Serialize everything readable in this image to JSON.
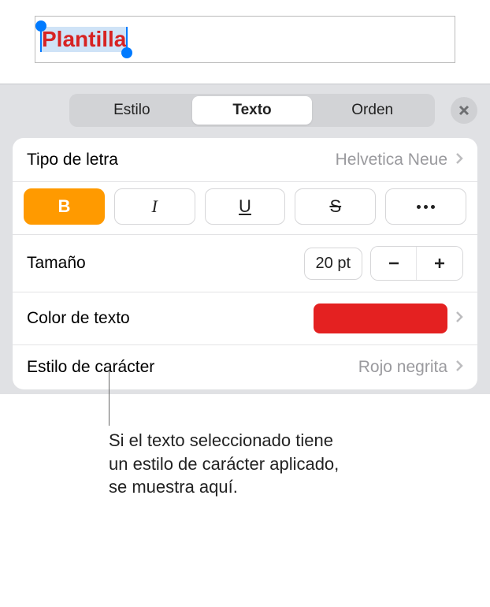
{
  "textbox": {
    "selected_text": "Plantilla"
  },
  "tabs": {
    "style": "Estilo",
    "text": "Texto",
    "order": "Orden"
  },
  "font": {
    "label": "Tipo de letra",
    "value": "Helvetica Neue"
  },
  "style_buttons": {
    "bold": "B",
    "italic": "I",
    "underline": "U",
    "strike": "S"
  },
  "size": {
    "label": "Tamaño",
    "value": "20 pt"
  },
  "text_color": {
    "label": "Color de texto",
    "swatch": "#e42121"
  },
  "char_style": {
    "label": "Estilo de carácter",
    "value": "Rojo negrita"
  },
  "callout": {
    "line1": "Si el texto seleccionado tiene",
    "line2": "un estilo de carácter aplicado,",
    "line3": "se muestra aquí."
  }
}
